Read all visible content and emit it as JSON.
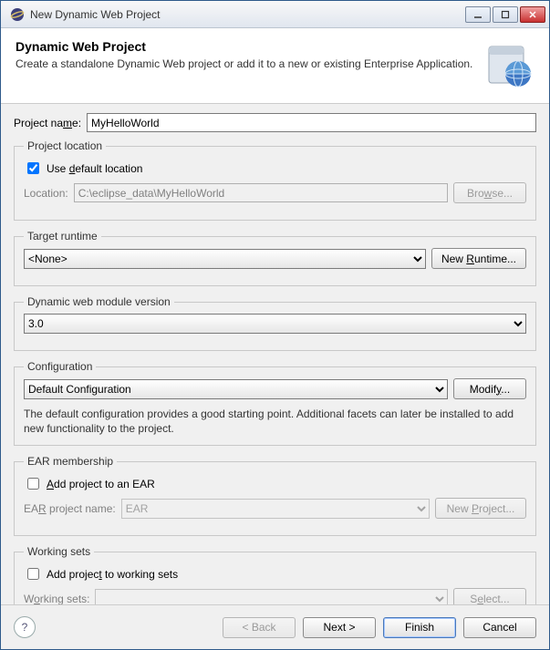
{
  "window": {
    "title": "New Dynamic Web Project"
  },
  "banner": {
    "heading": "Dynamic Web Project",
    "description": "Create a standalone Dynamic Web project or add it to a new or existing Enterprise Application."
  },
  "projectName": {
    "label": "Project name:",
    "value": "MyHelloWorld"
  },
  "projectLocation": {
    "legend": "Project location",
    "useDefault": {
      "checked": true,
      "prefix": "Use ",
      "u": "d",
      "suffix": "efault location"
    },
    "location": {
      "label": "Location:",
      "value": "C:\\eclipse_data\\MyHelloWorld"
    },
    "browse": {
      "label_prefix": "Bro",
      "label_u": "w",
      "label_suffix": "se..."
    }
  },
  "targetRuntime": {
    "legend": "Target runtime",
    "selected": "<None>",
    "newRuntime": {
      "prefix": "New ",
      "u": "R",
      "suffix": "untime..."
    }
  },
  "webModule": {
    "legend": "Dynamic web module version",
    "selected": "3.0"
  },
  "configuration": {
    "legend": "Configuration",
    "selected": "Default Configuration",
    "modify": {
      "prefix": "Modif",
      "u": "y",
      "suffix": "..."
    },
    "hint": "The default configuration provides a good starting point. Additional facets can later be installed to add new functionality to the project."
  },
  "ear": {
    "legend": "EAR membership",
    "addToEar": {
      "checked": false,
      "u": "A",
      "suffix": "dd project to an EAR"
    },
    "projectName": {
      "label_prefix": "EA",
      "label_u": "R",
      "label_suffix": " project name:",
      "value": "EAR"
    },
    "newProject": {
      "prefix": "New ",
      "u": "P",
      "suffix": "roject..."
    }
  },
  "workingSets": {
    "legend": "Working sets",
    "addToWs": {
      "checked": false,
      "prefix": "Add projec",
      "u": "t",
      "suffix": " to working sets"
    },
    "label": {
      "prefix": "W",
      "u": "o",
      "suffix": "rking sets:"
    },
    "select": {
      "prefix": "S",
      "u": "e",
      "suffix": "lect..."
    }
  },
  "footer": {
    "back": "< Back",
    "next": "Next >",
    "finish": "Finish",
    "cancel": "Cancel"
  }
}
